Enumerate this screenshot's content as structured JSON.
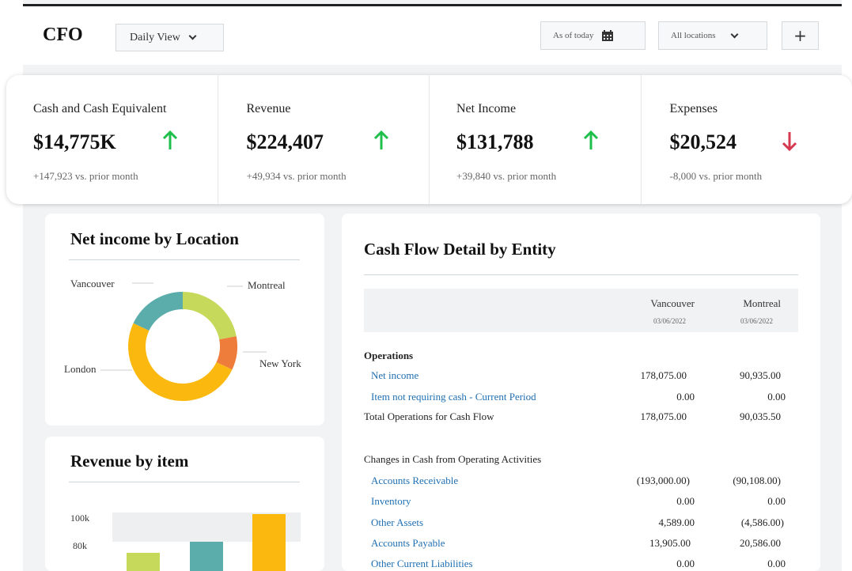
{
  "header": {
    "logo": "CFO",
    "view_select": "Daily View",
    "date_button": "As of today",
    "location_select": "All locations",
    "add_button": "+"
  },
  "kpis": [
    {
      "label": "Cash and Cash Equivalent",
      "value": "$14,775K",
      "delta": "+147,923 vs. prior month",
      "trend": "up"
    },
    {
      "label": "Revenue",
      "value": "$224,407",
      "delta": "+49,934 vs. prior month",
      "trend": "up"
    },
    {
      "label": "Net Income",
      "value": "$131,788",
      "delta": "+39,840 vs. prior month",
      "trend": "up"
    },
    {
      "label": "Expenses",
      "value": "$20,524",
      "delta": "-8,000 vs. prior month",
      "trend": "down"
    }
  ],
  "colors": {
    "up": "#1fbf4c",
    "down": "#d6394f",
    "link": "#1f6fb2",
    "vancouver": "#5aadaa",
    "montreal": "#c7d95a",
    "new_york": "#ee7d3b",
    "london": "#fbb80f"
  },
  "net_income_card": {
    "title": "Net income by Location",
    "chart_data": {
      "type": "pie",
      "labels": [
        "Montreal",
        "New York",
        "London",
        "Vancouver"
      ],
      "values": [
        22,
        10,
        50,
        18
      ]
    }
  },
  "revenue_card": {
    "title": "Revenue by item",
    "chart_data": {
      "type": "bar",
      "y_ticks": [
        "100k",
        "80k"
      ],
      "values": [
        75000,
        83000,
        103000
      ]
    }
  },
  "cashflow": {
    "title": "Cash Flow Detail by Entity",
    "columns": [
      {
        "name": "Vancouver",
        "date": "03/06/2022"
      },
      {
        "name": "Montreal",
        "date": "03/06/2022"
      }
    ],
    "sections": [
      {
        "heading": "Operations",
        "rows": [
          {
            "label": "Net income",
            "link": true,
            "v1": "178,075.00",
            "v2": "90,935.00"
          },
          {
            "label": "Item not requiring cash - Current Period",
            "link": true,
            "v1": "0.00",
            "v2": "0.00"
          },
          {
            "label": "Total Operations for Cash Flow",
            "link": false,
            "v1": "178,075.00",
            "v2": "90,035.50"
          }
        ]
      },
      {
        "heading": "Changes in Cash from Operating Activities",
        "rows": [
          {
            "label": "Accounts Receivable",
            "link": true,
            "v1": "(193,000.00)",
            "v2": "(90,108.00)"
          },
          {
            "label": "Inventory",
            "link": true,
            "v1": "0.00",
            "v2": "0.00"
          },
          {
            "label": "Other Assets",
            "link": true,
            "v1": "4,589.00",
            "v2": "(4,586.00)"
          },
          {
            "label": "Accounts Payable",
            "link": true,
            "v1": "13,905.00",
            "v2": "20,586.00"
          },
          {
            "label": "Other Current Liabilities",
            "link": true,
            "v1": "0.00",
            "v2": "0.00"
          }
        ]
      }
    ]
  }
}
